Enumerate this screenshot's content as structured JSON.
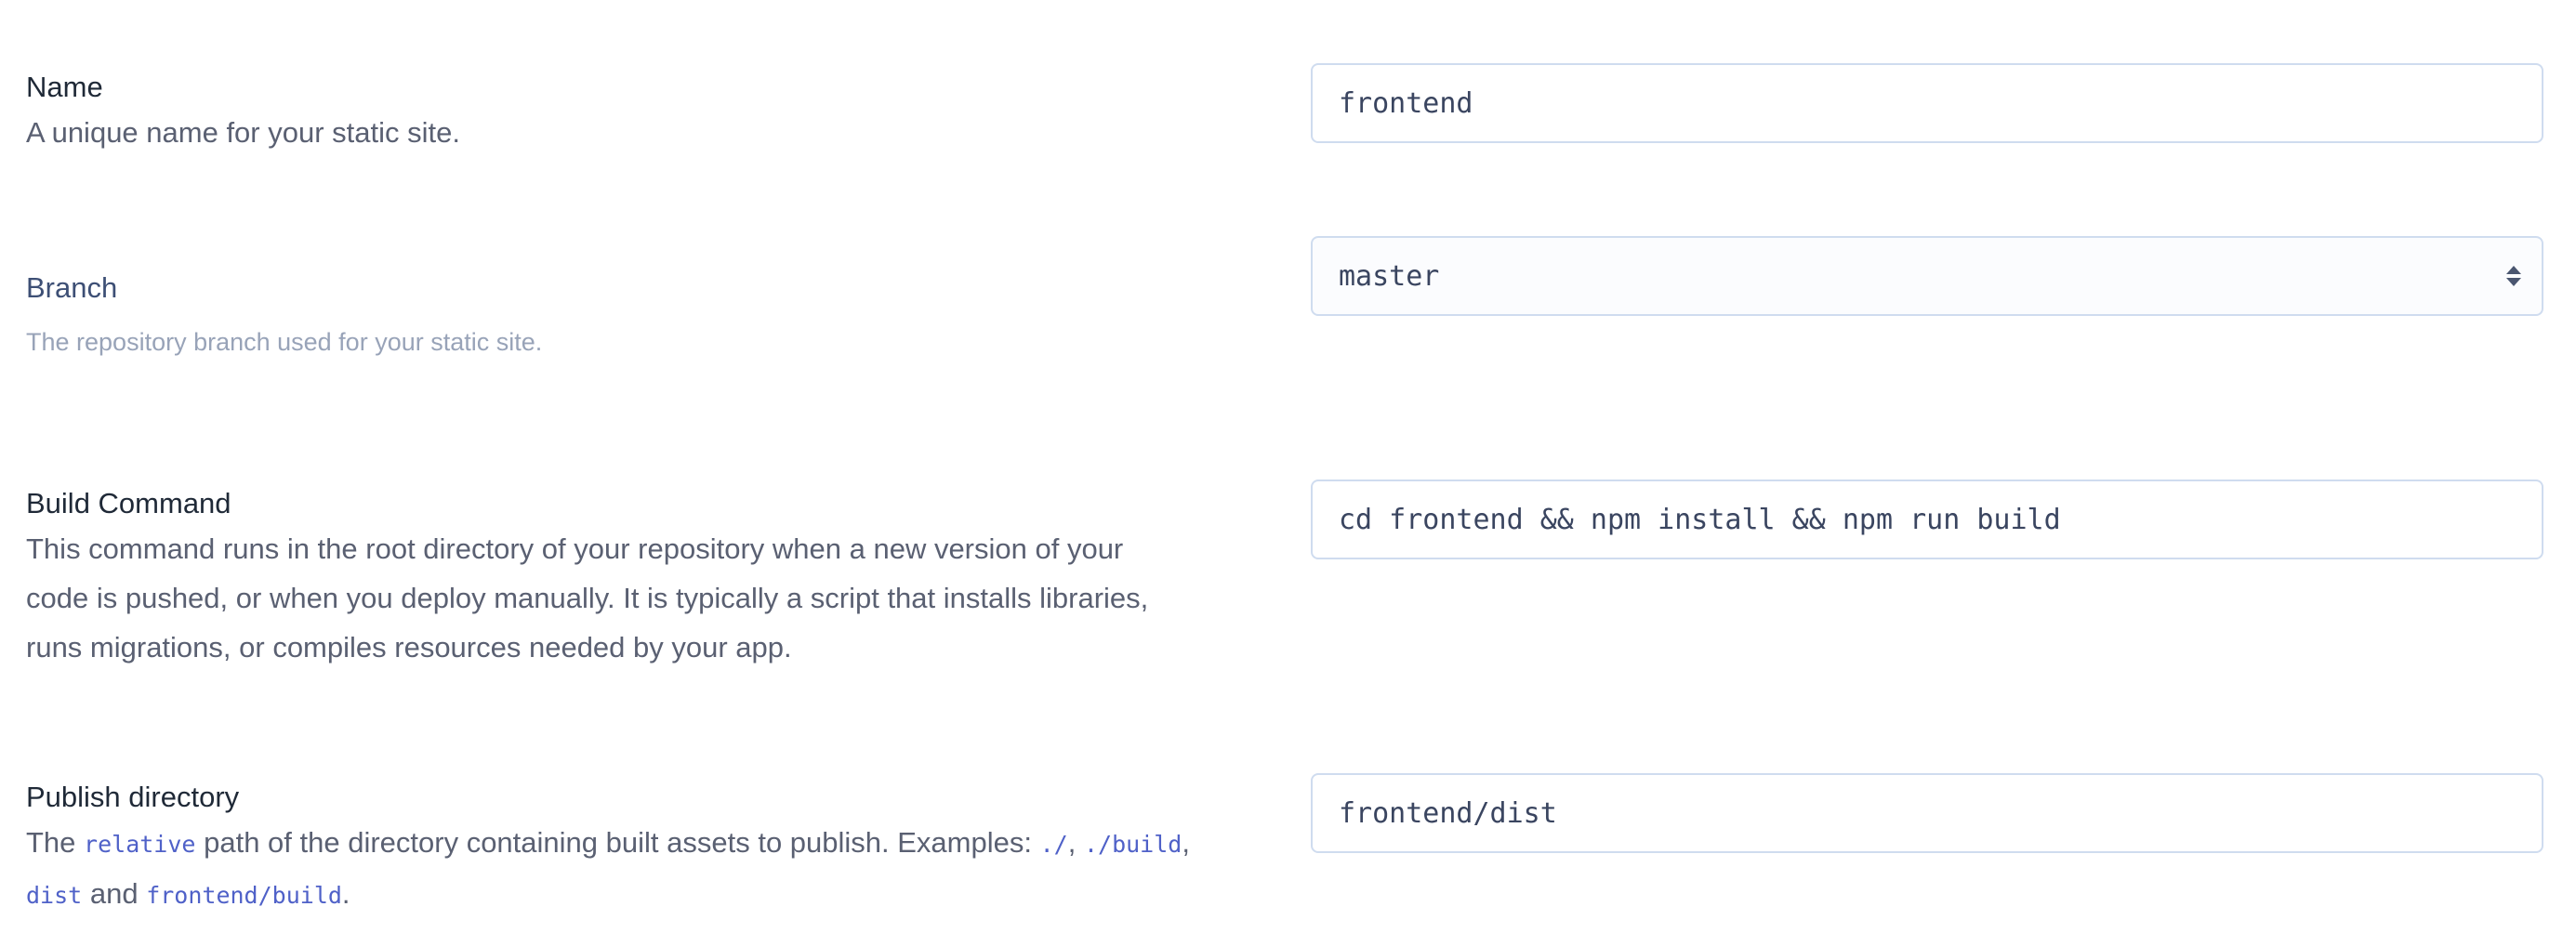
{
  "name_field": {
    "title": "Name",
    "description": "A unique name for your static site.",
    "value": "frontend"
  },
  "branch_field": {
    "title": "Branch",
    "description": "The repository branch used for your static site.",
    "value": "master"
  },
  "build_command_field": {
    "title": "Build Command",
    "description_line1": "This command runs in the root directory of your repository when a new version of your",
    "description_line2": "code is pushed, or when you deploy manually. It is typically a script that installs libraries,",
    "description_line3": "runs migrations, or compiles resources needed by your app.",
    "value": "cd frontend && npm install && npm run build"
  },
  "publish_directory_field": {
    "title": "Publish directory",
    "desc_the": "The",
    "desc_code_relative": "relative",
    "desc_middle": "path of the directory containing built assets to publish. Examples:",
    "desc_code_root": "./",
    "desc_comma1": ",",
    "desc_code_build": "./build",
    "desc_comma2": ",",
    "desc_code_dist": "dist",
    "desc_and": "and",
    "desc_code_frontend_build": "frontend/build",
    "desc_period": ".",
    "value": "frontend/dist"
  },
  "icons": {
    "select_caret": "up-down-caret-icon"
  }
}
